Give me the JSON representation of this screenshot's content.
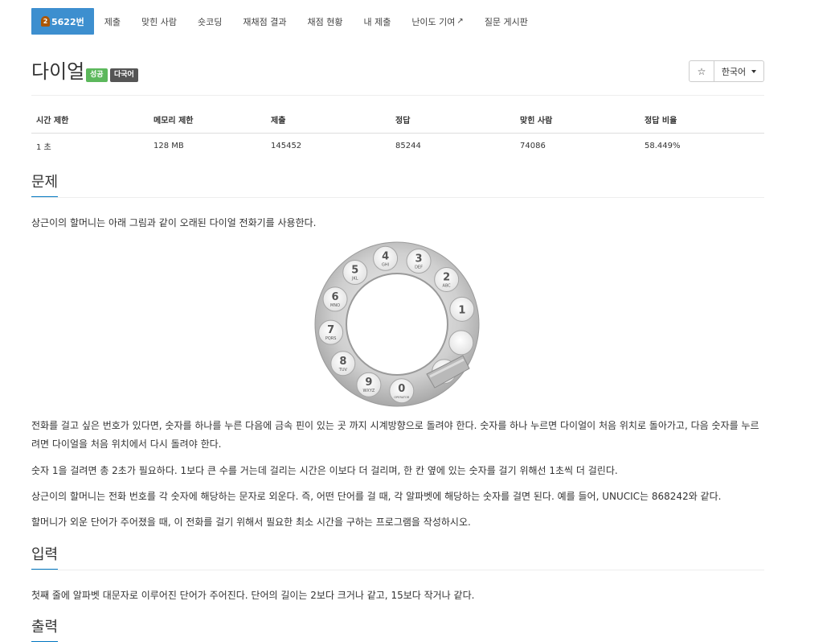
{
  "nav": {
    "problem_number": "5622번",
    "tier_badge": "2",
    "items": [
      "제출",
      "맞힌 사람",
      "숏코딩",
      "재채점 결과",
      "채점 현황",
      "내 제출",
      "난이도 기여",
      "질문 게시판"
    ]
  },
  "problem": {
    "title": "다이얼",
    "badge_success": "성공",
    "badge_multilang": "다국어",
    "language": "한국어",
    "star_icon": "☆"
  },
  "info": {
    "headers": [
      "시간 제한",
      "메모리 제한",
      "제출",
      "정답",
      "맞힌 사람",
      "정답 비율"
    ],
    "values": [
      "1 초",
      "128 MB",
      "145452",
      "85244",
      "74086",
      "58.449%"
    ]
  },
  "sections": {
    "problem_title": "문제",
    "intro": "상근이의 할머니는 아래 그림과 같이 오래된 다이얼 전화기를 사용한다.",
    "p1": "전화를 걸고 싶은 번호가 있다면, 숫자를 하나를 누른 다음에 금속 핀이 있는 곳 까지 시계방향으로 돌려야 한다. 숫자를 하나 누르면 다이얼이 처음 위치로 돌아가고, 다음 숫자를 누르려면 다이얼을 처음 위치에서 다시 돌려야 한다.",
    "p2": "숫자 1을 걸려면 총 2초가 필요하다. 1보다 큰 수를 거는데 걸리는 시간은 이보다 더 걸리며, 한 칸 옆에 있는 숫자를 걸기 위해선 1초씩 더 걸린다.",
    "p3": "상근이의 할머니는 전화 번호를 각 숫자에 해당하는 문자로 외운다. 즉, 어떤 단어를 걸 때, 각 알파벳에 해당하는 숫자를 걸면 된다. 예를 들어, UNUCIC는 868242와 같다.",
    "p4": "할머니가 외운 단어가 주어졌을 때, 이 전화를 걸기 위해서 필요한 최소 시간을 구하는 프로그램을 작성하시오.",
    "input_title": "입력",
    "input_text": "첫째 줄에 알파벳 대문자로 이루어진 단어가 주어진다. 단어의 길이는 2보다 크거나 같고, 15보다 작거나 같다.",
    "output_title": "출력"
  },
  "dial": {
    "holes": [
      {
        "digit": "1",
        "letters": ""
      },
      {
        "digit": "2",
        "letters": "ABC"
      },
      {
        "digit": "3",
        "letters": "DEF"
      },
      {
        "digit": "4",
        "letters": "GHI"
      },
      {
        "digit": "5",
        "letters": "JKL"
      },
      {
        "digit": "6",
        "letters": "MNO"
      },
      {
        "digit": "7",
        "letters": "PQRS"
      },
      {
        "digit": "8",
        "letters": "TUV"
      },
      {
        "digit": "9",
        "letters": "WXYZ"
      },
      {
        "digit": "0",
        "letters": "OPERATOR"
      },
      {
        "digit": "",
        "letters": ""
      },
      {
        "digit": "",
        "letters": ""
      }
    ]
  },
  "colors": {
    "nav_active": "#3d8fcf",
    "tier_bronze": "#ad5600",
    "success": "#5cb85c",
    "section_underline": "#0076c0"
  }
}
